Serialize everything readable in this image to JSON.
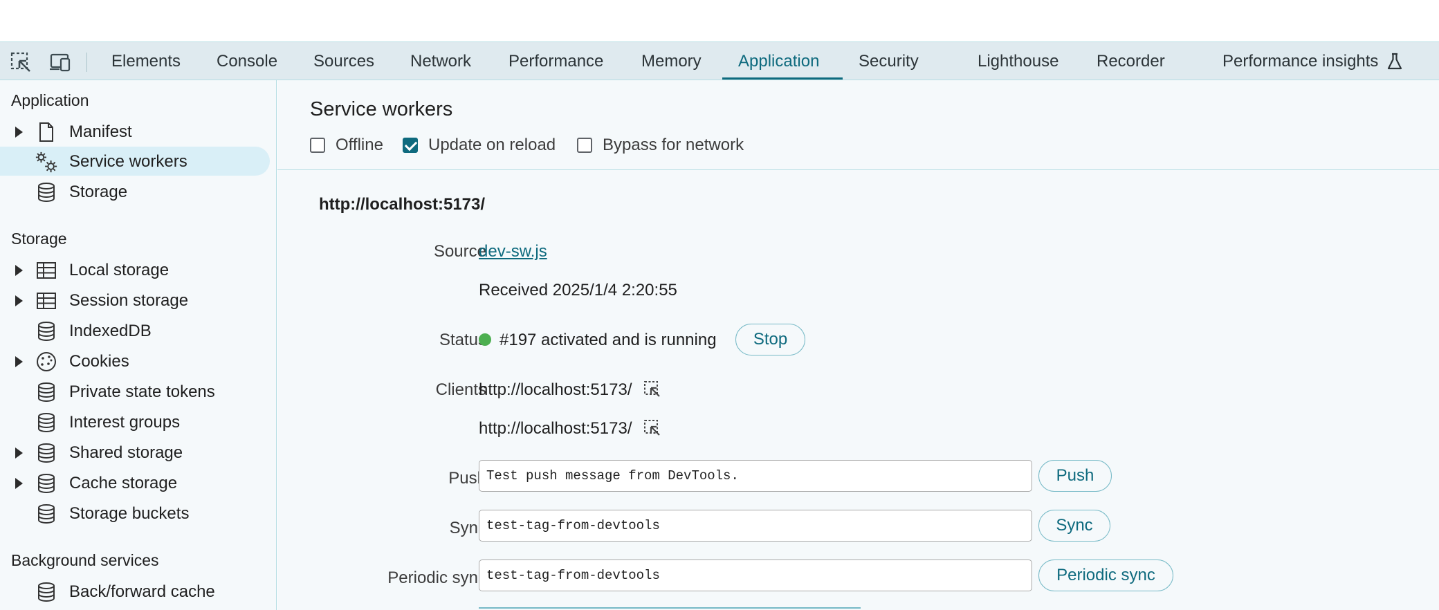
{
  "toolbar": {
    "inspect_icon": "inspect-element-icon",
    "device_icon": "device-toolbar-icon",
    "tabs": [
      {
        "label": "Elements"
      },
      {
        "label": "Console"
      },
      {
        "label": "Sources"
      },
      {
        "label": "Network"
      },
      {
        "label": "Performance"
      },
      {
        "label": "Memory"
      },
      {
        "label": "Application"
      },
      {
        "label": "Security"
      },
      {
        "label": "Lighthouse"
      },
      {
        "label": "Recorder"
      },
      {
        "label": "Performance insights"
      }
    ],
    "active_tab": "Application",
    "accent_color": "#0e6a7e"
  },
  "sidebar": {
    "sections": [
      {
        "title": "Application"
      },
      {
        "title": "Storage"
      },
      {
        "title": "Background services"
      }
    ],
    "items": [
      {
        "label": "Manifest",
        "icon": "document-icon",
        "expandable": true
      },
      {
        "label": "Service workers",
        "icon": "gears-icon",
        "selected": true
      },
      {
        "label": "Storage",
        "icon": "database-icon"
      },
      {
        "label": "Local storage",
        "icon": "table-icon",
        "expandable": true
      },
      {
        "label": "Session storage",
        "icon": "table-icon",
        "expandable": true
      },
      {
        "label": "IndexedDB",
        "icon": "database-icon"
      },
      {
        "label": "Cookies",
        "icon": "cookie-icon",
        "expandable": true
      },
      {
        "label": "Private state tokens",
        "icon": "database-icon"
      },
      {
        "label": "Interest groups",
        "icon": "database-icon"
      },
      {
        "label": "Shared storage",
        "icon": "database-icon",
        "expandable": true
      },
      {
        "label": "Cache storage",
        "icon": "database-icon",
        "expandable": true
      },
      {
        "label": "Storage buckets",
        "icon": "database-icon"
      },
      {
        "label": "Back/forward cache",
        "icon": "database-icon"
      }
    ]
  },
  "main": {
    "title": "Service workers",
    "options": [
      {
        "label": "Offline",
        "checked": false
      },
      {
        "label": "Update on reload",
        "checked": true
      },
      {
        "label": "Bypass for network",
        "checked": false
      }
    ],
    "origin": "http://localhost:5173/",
    "source_label": "Source",
    "source_link": "dev-sw.js",
    "received": "Received 2025/1/4 2:20:55",
    "status_label": "Status",
    "status_text": "#197 activated and is running",
    "status_color": "#4caf50",
    "stop_button": "Stop",
    "clients_label": "Clients",
    "clients": [
      "http://localhost:5173/",
      "http://localhost:5173/"
    ],
    "push_label": "Push",
    "push_value": "Test push message from DevTools.",
    "push_button": "Push",
    "sync_label": "Sync",
    "sync_value": "test-tag-from-devtools",
    "sync_button": "Sync",
    "periodic_label": "Periodic sync",
    "periodic_value": "test-tag-from-devtools",
    "periodic_button": "Periodic sync"
  }
}
